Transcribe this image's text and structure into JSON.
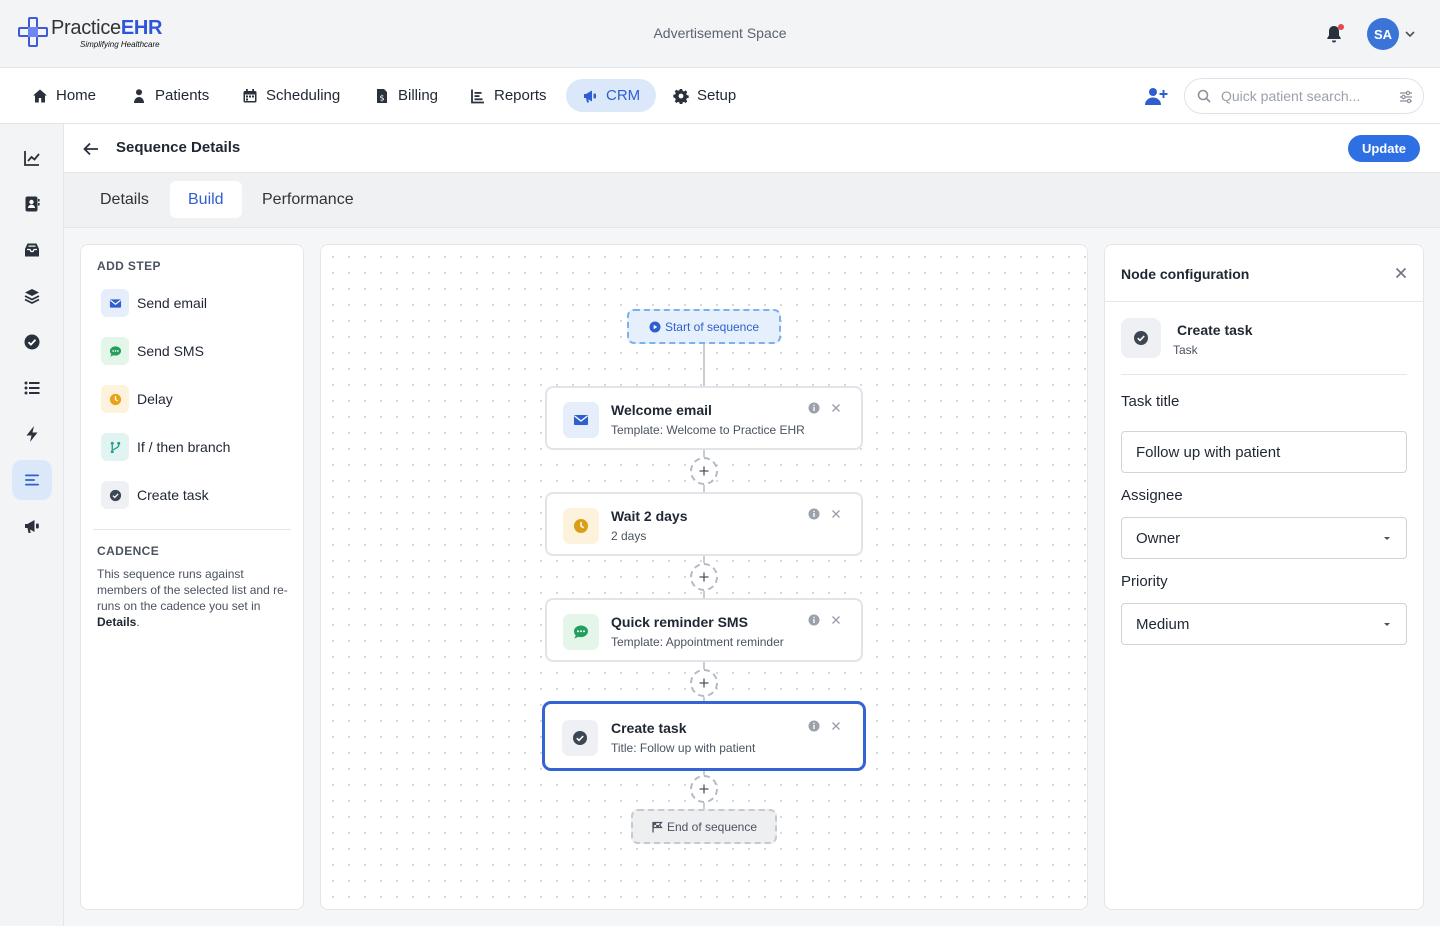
{
  "app": {
    "logo_prefix": "Practice",
    "logo_brand": "EHR",
    "logo_tagline": "Simplifying Healthcare",
    "ad_text": "Advertisement Space",
    "user_initials": "SA"
  },
  "nav": {
    "items": [
      {
        "label": "Home",
        "icon": "home-icon"
      },
      {
        "label": "Patients",
        "icon": "patients-icon"
      },
      {
        "label": "Scheduling",
        "icon": "calendar-icon"
      },
      {
        "label": "Billing",
        "icon": "billing-icon"
      },
      {
        "label": "Reports",
        "icon": "reports-icon"
      },
      {
        "label": "CRM",
        "icon": "megaphone-icon",
        "active": true
      },
      {
        "label": "Setup",
        "icon": "gear-icon"
      }
    ],
    "search_placeholder": "Quick patient search..."
  },
  "rail": {
    "icons": [
      "analytics-icon",
      "contacts-icon",
      "inbox-icon",
      "layers-icon",
      "check-circle-icon",
      "list-icon",
      "lightning-icon",
      "sequence-icon",
      "megaphone-icon"
    ],
    "active_index": 7
  },
  "page": {
    "title": "Sequence Details",
    "update_label": "Update",
    "tabs": [
      "Details",
      "Build",
      "Performance"
    ],
    "active_tab": "Build"
  },
  "add_step": {
    "heading": "ADD STEP",
    "steps": [
      {
        "label": "Send email",
        "icon": "mail-icon"
      },
      {
        "label": "Send SMS",
        "icon": "chat-icon"
      },
      {
        "label": "Delay",
        "icon": "clock-icon"
      },
      {
        "label": "If / then branch",
        "icon": "branch-icon"
      },
      {
        "label": "Create task",
        "icon": "check-circle-icon"
      }
    ],
    "cadence_heading": "CADENCE",
    "cadence_text": "This sequence runs against members of the selected list and re-runs on the cadence you set in ",
    "cadence_link": "Details",
    "cadence_end": "."
  },
  "canvas": {
    "start_label": "Start of sequence",
    "end_label": "End of sequence",
    "nodes": [
      {
        "title": "Welcome email",
        "subtitle": "Template: Welcome to Practice EHR",
        "icon": "mail-icon"
      },
      {
        "title": "Wait 2 days",
        "subtitle": "2 days",
        "icon": "clock-icon"
      },
      {
        "title": "Quick reminder SMS",
        "subtitle": "Template: Appointment reminder",
        "icon": "chat-icon"
      },
      {
        "title": "Create task",
        "subtitle": "Title: Follow up with patient",
        "icon": "check-circle-icon",
        "selected": true
      }
    ]
  },
  "config": {
    "heading": "Node configuration",
    "node_title": "Create task",
    "node_type": "Task",
    "task_title_label": "Task title",
    "task_title_value": "Follow up with patient",
    "assignee_label": "Assignee",
    "assignee_value": "Owner",
    "priority_label": "Priority",
    "priority_value": "Medium"
  },
  "colors": {
    "accent": "#2f6fe4",
    "active_nav_bg": "#dbe8fa",
    "email": "#2f5fcf",
    "sms": "#22a05b",
    "delay": "#d9a016",
    "branch": "#1f9c8a",
    "task": "#3d4653"
  }
}
